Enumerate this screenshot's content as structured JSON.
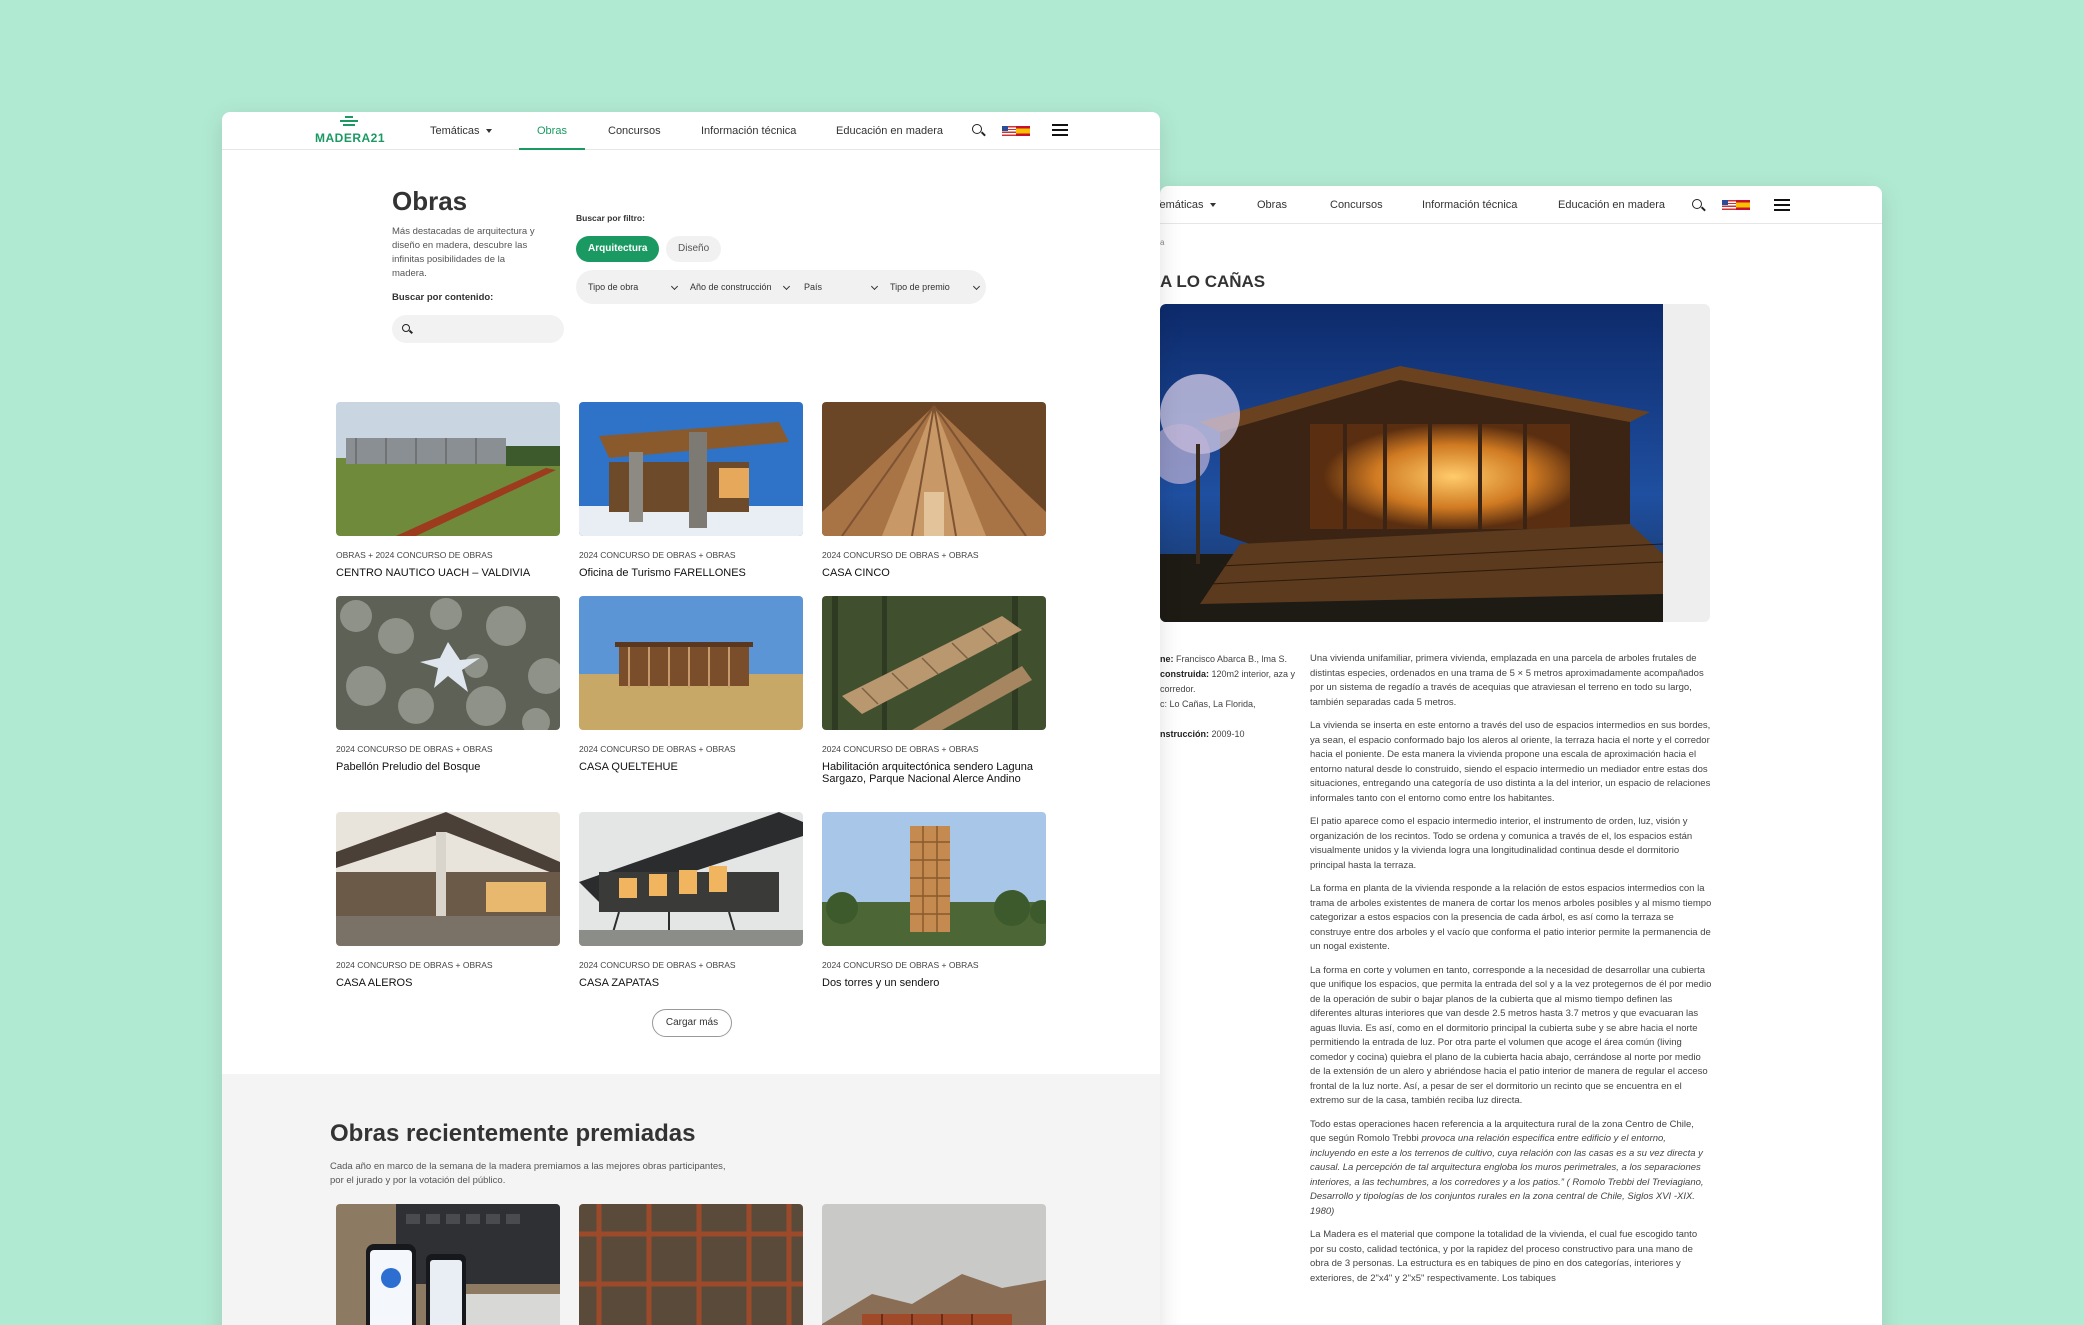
{
  "front": {
    "logo": {
      "text": "MADERA21"
    },
    "nav": {
      "tematicas": "Temáticas",
      "obras": "Obras",
      "concursos": "Concursos",
      "info": "Información técnica",
      "educacion": "Educación en madera"
    },
    "header": {
      "title": "Obras",
      "description": "Más destacadas de arquitectura y diseño en madera, descubre las infinitas posibilidades de la madera.",
      "search_label": "Buscar por contenido:",
      "filter_label": "Buscar por filtro:"
    },
    "toggles": {
      "arquitectura": "Arquitectura",
      "diseno": "Diseño"
    },
    "filters": {
      "tipo_obra": "Tipo de obra",
      "anio": "Año de construcción",
      "pais": "País",
      "premio": "Tipo de premio"
    },
    "cards": [
      {
        "tags": "OBRAS + 2024 CONCURSO DE OBRAS",
        "title": "CENTRO NAUTICO UACH – VALDIVIA"
      },
      {
        "tags": "2024 CONCURSO DE OBRAS + OBRAS",
        "title": "Oficina de Turismo FARELLONES"
      },
      {
        "tags": "2024 CONCURSO DE OBRAS + OBRAS",
        "title": "CASA CINCO"
      },
      {
        "tags": "2024 CONCURSO DE OBRAS + OBRAS",
        "title": "Pabellón Preludio del Bosque"
      },
      {
        "tags": "2024 CONCURSO DE OBRAS + OBRAS",
        "title": "CASA QUELTEHUE"
      },
      {
        "tags": "2024 CONCURSO DE OBRAS + OBRAS",
        "title": "Habilitación arquitectónica sendero Laguna Sargazo, Parque Nacional Alerce Andino"
      },
      {
        "tags": "2024 CONCURSO DE OBRAS + OBRAS",
        "title": "CASA ALEROS"
      },
      {
        "tags": "2024 CONCURSO DE OBRAS + OBRAS",
        "title": "CASA ZAPATAS"
      },
      {
        "tags": "2024 CONCURSO DE OBRAS + OBRAS",
        "title": "Dos torres y un sendero"
      }
    ],
    "load_more": "Cargar más",
    "awards": {
      "title": "Obras recientemente premiadas",
      "description": "Cada año en marco de la semana de la madera premiamos a las mejores obras participantes, por el jurado y por la votación del público."
    }
  },
  "back": {
    "nav": {
      "tematicas": "Temáticas",
      "obras": "Obras",
      "concursos": "Concursos",
      "info": "Información técnica",
      "educacion": "Educación en madera"
    },
    "crumb": "a",
    "title": "A LO CAÑAS",
    "meta": [
      {
        "label": "ne:",
        "value": " Francisco Abarca B., lma S."
      },
      {
        "label": " construida:",
        "value": " 120m2 interior, aza y corredor."
      },
      {
        "label": "",
        "value": "c: Lo Cañas, La Florida,"
      },
      {
        "label": "nstrucción:",
        "value": " 2009-10"
      }
    ],
    "article": [
      "Una vivienda unifamiliar, primera vivienda, emplazada en una parcela de arboles frutales de distintas especies, ordenados en una trama de 5 × 5 metros aproximadamente acompañados por un sistema de regadío a través de acequias que atraviesan el terreno en todo su largo, también separadas cada 5 metros.",
      "La vivienda se inserta en este entorno a través del uso de espacios intermedios en sus bordes, ya sean, el espacio conformado bajo los aleros al oriente, la terraza hacia el norte y el corredor hacia el poniente. De esta manera la vivienda propone una escala de aproximación hacia el entorno natural desde lo construido, siendo el espacio intermedio un mediador entre estas dos situaciones, entregando una categoría de uso distinta a la del interior, un espacio de relaciones informales tanto con el entorno como entre los habitantes.",
      "El patio aparece como el espacio intermedio interior, el instrumento de orden, luz, visión y organización de los recintos. Todo se ordena y comunica a través de el, los espacios están visualmente unidos y la vivienda logra una longitudinalidad continua desde el dormitorio principal hasta la terraza.",
      "La forma en planta de la vivienda responde a la relación de estos espacios intermedios con la trama de arboles existentes de manera de cortar los menos arboles posibles y al mismo tiempo categorizar a estos espacios con la presencia de cada árbol, es así como la terraza se construye entre dos arboles y el vacío que conforma el patio interior permite la permanencia de un nogal existente.",
      "La forma en corte y volumen en tanto, corresponde a la necesidad de desarrollar una cubierta que unifique los espacios, que permita la entrada del sol y a la vez protegernos de él por medio de la operación de subir o bajar planos de la cubierta que al mismo tiempo definen las diferentes alturas interiores que van desde 2.5 metros hasta 3.7 metros y que evacuaran las aguas lluvia. Es así, como en el dormitorio principal la cubierta sube y se abre hacia el norte permitiendo la entrada de luz. Por otra parte el volumen que acoge el área común (living comedor y cocina) quiebra el plano de la cubierta hacia abajo, cerrándose al norte por medio de la extensión de un alero y abriéndose hacia el patio interior de manera de regular el acceso frontal de la luz norte. Así, a pesar de ser el dormitorio un recinto que se encuentra en el extremo sur de la casa, también reciba luz directa.",
      "Todo estas operaciones hacen referencia a la arquitectura rural de la zona Centro de Chile, que según Romolo Trebbi",
      "provoca una relación especifica entre edificio y el entorno, incluyendo en este a los terrenos de cultivo, cuya relación con las casas es a su vez directa y causal. La percepción de tal arquitectura engloba los muros perimetrales, a los separaciones interiores, a las techumbres, a los corredores y a los patios.” ( Romolo Trebbi del Treviagiano, Desarrollo y tipologías de los conjuntos rurales en la zona central de Chile, Siglos XVI -XIX. 1980)",
      "La Madera es el material que compone la totalidad de la vivienda, el cual fue escogido tanto por su costo, calidad tectónica, y por la rapidez del proceso constructivo para una mano de obra de 3 personas. La estructura es en tabiques de pino en dos categorías, interiores y exteriores, de 2\"x4\" y 2\"x5\" respectivamente. Los tabiques"
    ]
  }
}
